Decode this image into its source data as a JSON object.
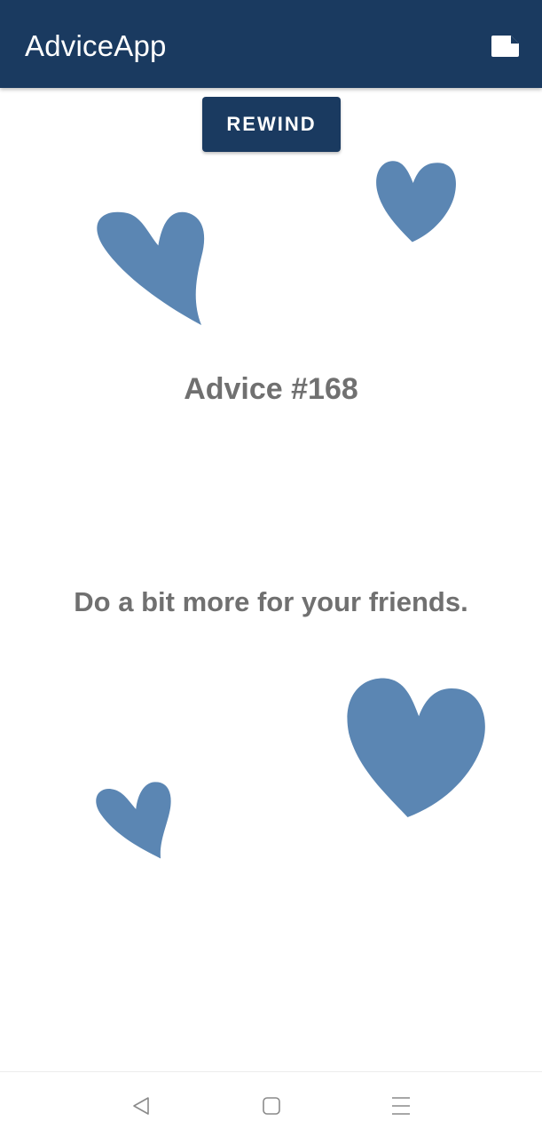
{
  "app_bar": {
    "title": "AdviceApp",
    "background_color": "#1a3a60",
    "action_icon": "note-icon"
  },
  "rewind_button": {
    "label": "REWIND",
    "background_color": "#1a3a60"
  },
  "advice": {
    "number_label": "Advice #168",
    "text": "Do a bit more for your friends.",
    "text_color": "#707070"
  },
  "decorations": {
    "icon": "heart-icon",
    "color": "#5b86b3",
    "count": 4
  },
  "nav_bar": {
    "back_icon": "back-triangle-icon",
    "home_icon": "home-square-icon",
    "menu_icon": "menu-lines-icon"
  }
}
